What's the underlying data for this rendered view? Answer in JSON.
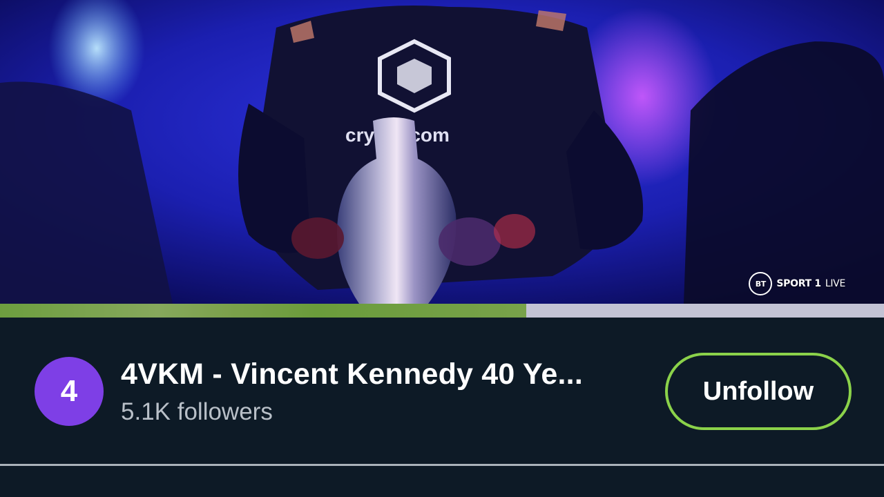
{
  "video": {
    "broadcaster_logo_text": "BT",
    "broadcaster_channel": "SPORT 1",
    "broadcaster_live": "LIVE",
    "shirt_sponsor": "crypto.com",
    "progress_fraction": 0.595
  },
  "channel": {
    "avatar_letter": "4",
    "title": "4VKM - Vincent Kennedy 40 Ye...",
    "followers": "5.1K followers",
    "unfollow_label": "Unfollow"
  },
  "colors": {
    "panel_background": "#0d1a26",
    "avatar": "#7e3fe6",
    "follow_border": "#8bd24a",
    "progress_played": "#6d9e3f",
    "progress_remaining": "#c3c3d4"
  }
}
